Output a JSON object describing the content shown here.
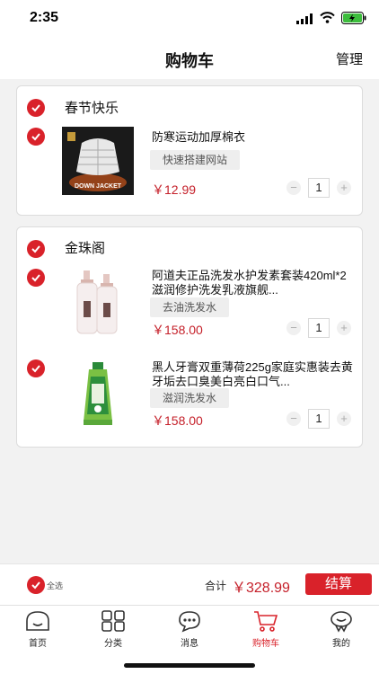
{
  "status_bar": {
    "time": "2:35"
  },
  "header": {
    "title": "购物车",
    "manage_label": "管理"
  },
  "shops": [
    {
      "name": "春节快乐",
      "items": [
        {
          "title": "防寒运动加厚棉衣",
          "spec": "快速搭建网站",
          "price": "￥12.99",
          "quantity": "1",
          "image": "down-jacket-thumb",
          "image_text": "DOWN JACKET"
        }
      ]
    },
    {
      "name": "金珠阁",
      "items": [
        {
          "title": "阿道夫正品洗发水护发素套装420ml*2滋润修护洗发乳液旗舰...",
          "spec": "去油洗发水",
          "price": "￥158.00",
          "quantity": "1",
          "image": "shampoo-bottles-thumb"
        },
        {
          "title": "黑人牙膏双重薄荷225g家庭实惠装去黄牙垢去口臭美白亮白口气...",
          "spec": "滋润洗发水",
          "price": "￥158.00",
          "quantity": "1",
          "image": "toothpaste-thumb"
        }
      ]
    }
  ],
  "checkout": {
    "select_all_label": "全选",
    "total_label": "合计",
    "total_value": "￥328.99",
    "checkout_label": "结算"
  },
  "tabs": [
    {
      "label": "首页",
      "icon": "home-icon"
    },
    {
      "label": "分类",
      "icon": "category-icon"
    },
    {
      "label": "消息",
      "icon": "message-icon"
    },
    {
      "label": "购物车",
      "icon": "cart-icon",
      "active": true
    },
    {
      "label": "我的",
      "icon": "profile-icon"
    }
  ],
  "colors": {
    "accent": "#d9222a",
    "price": "#c5202a",
    "background": "#f2f2f2"
  }
}
